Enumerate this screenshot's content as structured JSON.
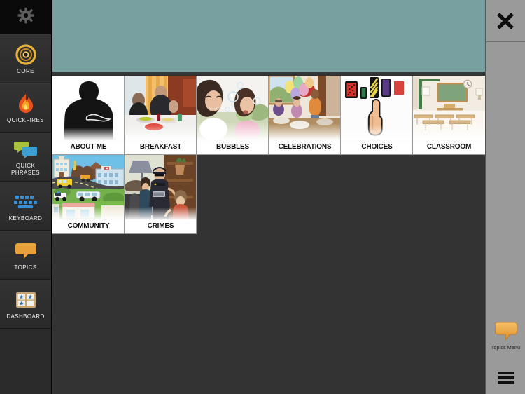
{
  "app": {
    "background_color": "#333333",
    "sidebar_color": "#2b2b2b",
    "message_bar_color": "#78a0a0",
    "right_panel_color": "#9a9a9a"
  },
  "sidebar": {
    "settings": {
      "icon": "gear-icon",
      "label": ""
    },
    "items": [
      {
        "label": "CORE",
        "icon": "target-icon",
        "color": "#e8b23a"
      },
      {
        "label": "QUICKFIRES",
        "icon": "flame-icon",
        "color": "#e8601c"
      },
      {
        "label": "QUICK\nPHRASES",
        "icon": "speech-bubbles-icon",
        "color": "#3b9fd4"
      },
      {
        "label": "KEYBOARD",
        "icon": "keyboard-icon",
        "color": "#3b8fd4"
      },
      {
        "label": "TOPICS",
        "icon": "speech-bubble-icon",
        "color": "#e8a13a"
      },
      {
        "label": "DASHBOARD",
        "icon": "dashboard-grid-icon",
        "color": "#c9a46b"
      }
    ]
  },
  "message_bar": {
    "text": ""
  },
  "grid": {
    "columns": 6,
    "rows": 2,
    "cells": [
      {
        "label": "ABOUT ME",
        "art": "person-silhouette"
      },
      {
        "label": "BREAKFAST",
        "art": "family-eating-photo"
      },
      {
        "label": "BUBBLES",
        "art": "girls-blowing-bubbles-photo"
      },
      {
        "label": "CELEBRATIONS",
        "art": "party-balloons-scene"
      },
      {
        "label": "CHOICES",
        "art": "pointing-finger-cards"
      },
      {
        "label": "CLASSROOM",
        "art": "classroom-chalkboard-scene"
      },
      {
        "label": "COMMUNITY",
        "art": "town-street-scene"
      },
      {
        "label": "CRIMES",
        "art": "police-officer-scene"
      }
    ]
  },
  "right_panel": {
    "close_button": {
      "icon": "close-icon",
      "label": "X"
    },
    "topics_menu": {
      "icon": "speech-bubble-icon",
      "label": "Topics Menu"
    },
    "hamburger": {
      "icon": "hamburger-menu-icon",
      "label": ""
    }
  }
}
